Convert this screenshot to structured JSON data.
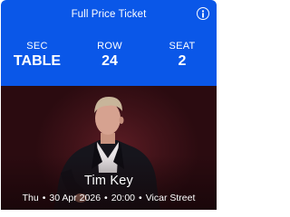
{
  "ticket": {
    "type_label": "Full Price Ticket",
    "info_icon": "info-icon"
  },
  "seat_info": {
    "sec_label": "SEC",
    "sec_value": "TABLE",
    "row_label": "ROW",
    "row_value": "24",
    "seat_label": "SEAT",
    "seat_value": "2"
  },
  "event": {
    "performer": "Tim Key",
    "day": "Thu",
    "date": "30 Apr 2026",
    "time": "20:00",
    "venue": "Vicar Street",
    "separator": "•"
  },
  "colors": {
    "header_bg": "#0a57e8",
    "photo_bg": "#4a141b",
    "text": "#ffffff"
  }
}
